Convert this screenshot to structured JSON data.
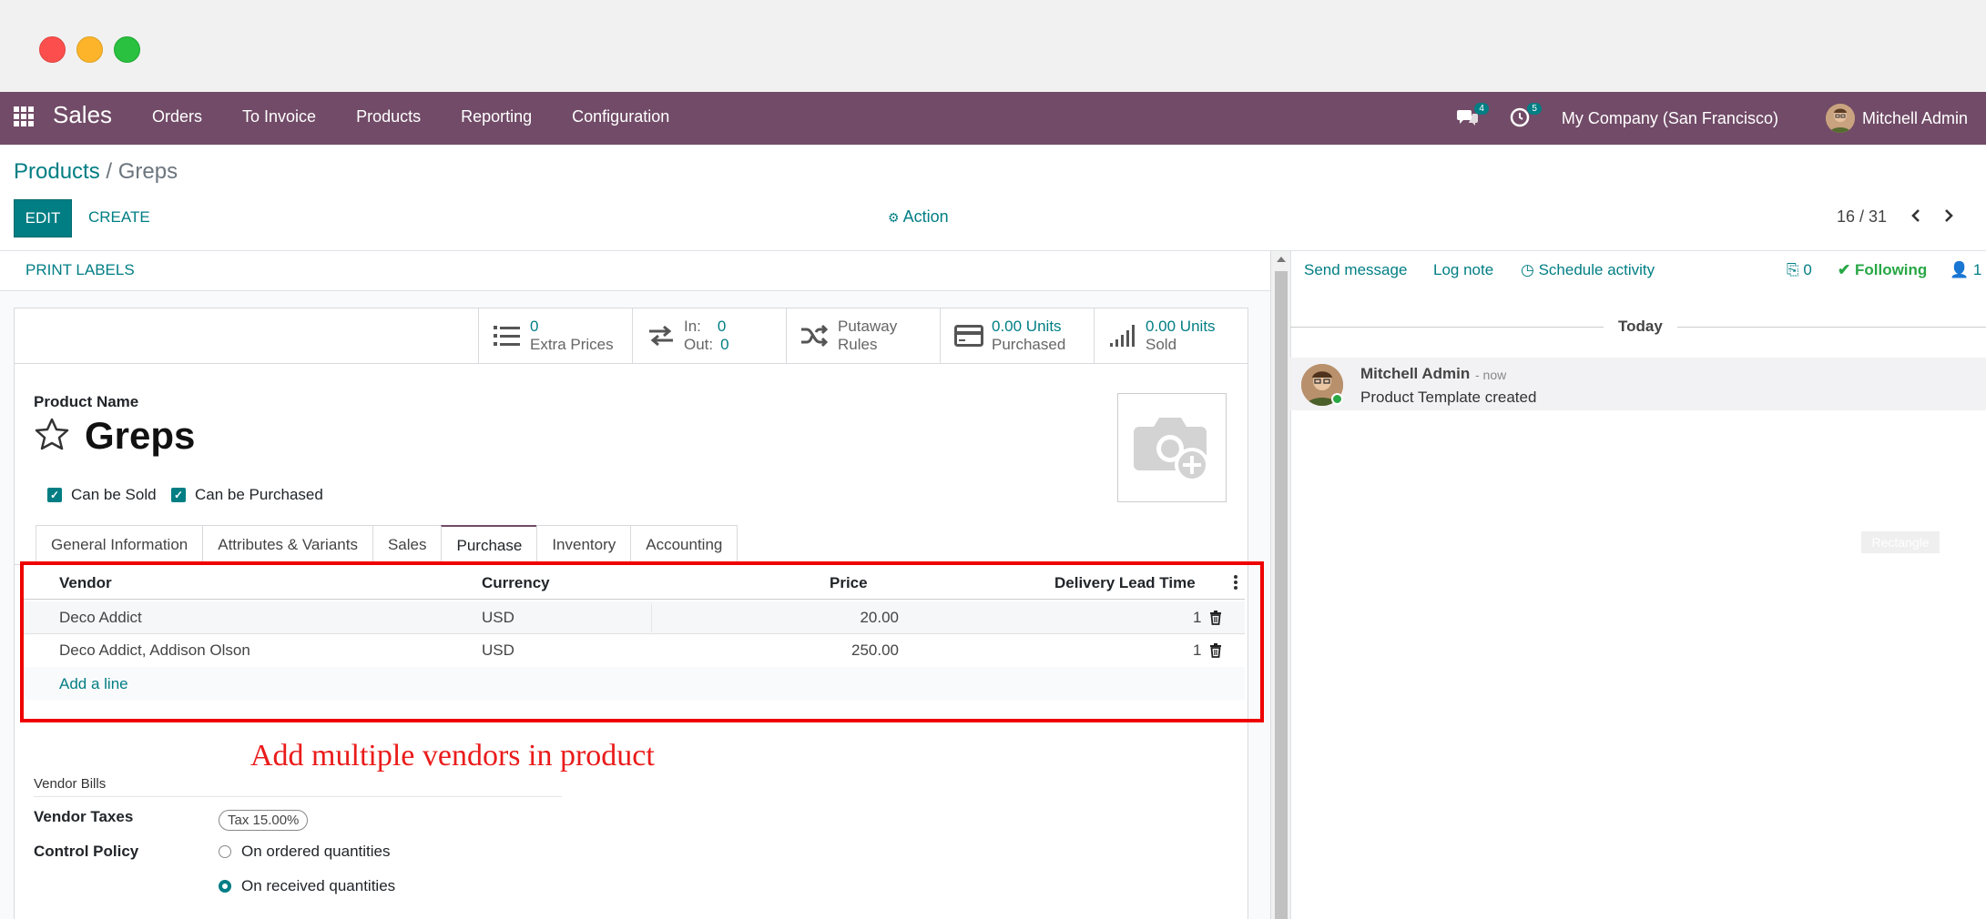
{
  "navbar": {
    "brand": "Sales",
    "menu": [
      "Orders",
      "To Invoice",
      "Products",
      "Reporting",
      "Configuration"
    ],
    "messages_count": "4",
    "activities_count": "5",
    "company": "My Company (San Francisco)",
    "user": "Mitchell Admin"
  },
  "breadcrumb": {
    "parent": "Products",
    "separator": "/",
    "current": "Greps"
  },
  "toolbar": {
    "edit_label": "EDIT",
    "create_label": "CREATE",
    "action_label": "Action",
    "pager": "16 / 31"
  },
  "statusbar": {
    "print_labels": "PRINT LABELS"
  },
  "smart_buttons": {
    "extra_prices_value": "0",
    "extra_prices_label": "Extra Prices",
    "in_label": "In:",
    "in_value": "0",
    "out_label": "Out:",
    "out_value": "0",
    "putaway_line1": "Putaway",
    "putaway_line2": "Rules",
    "purchased_value": "0.00 Units",
    "purchased_label": "Purchased",
    "sold_value": "0.00 Units",
    "sold_label": "Sold"
  },
  "product": {
    "name_label": "Product Name",
    "name": "Greps",
    "can_be_sold": "Can be Sold",
    "can_be_purchased": "Can be Purchased"
  },
  "tabs": [
    "General Information",
    "Attributes & Variants",
    "Sales",
    "Purchase",
    "Inventory",
    "Accounting"
  ],
  "vendor_table": {
    "columns": [
      "Vendor",
      "Currency",
      "Price",
      "Delivery Lead Time"
    ],
    "rows": [
      {
        "vendor": "Deco Addict",
        "currency": "USD",
        "price": "20.00",
        "lead_time": "1"
      },
      {
        "vendor": "Deco Addict, Addison Olson",
        "currency": "USD",
        "price": "250.00",
        "lead_time": "1"
      }
    ],
    "add_line": "Add a line"
  },
  "annotation": "Add multiple vendors in product",
  "vendor_bills": {
    "section_label": "Vendor Bills",
    "taxes_label": "Vendor Taxes",
    "tax_tag": "Tax 15.00%",
    "control_policy_label": "Control Policy",
    "option_ordered": "On ordered quantities",
    "option_received": "On received quantities",
    "selected": "On received quantities"
  },
  "chatter": {
    "send_message": "Send message",
    "log_note": "Log note",
    "schedule_activity": "Schedule activity",
    "attachments": "0",
    "following": "Following",
    "followers": "1",
    "date_separator": "Today",
    "message_author": "Mitchell Admin",
    "message_time": "- now",
    "message_body": "Product Template created",
    "rect_label": "Rectangle"
  },
  "colors": {
    "navbar": "#714b67",
    "accent": "#017e84",
    "annotation_red": "#ef0000"
  }
}
